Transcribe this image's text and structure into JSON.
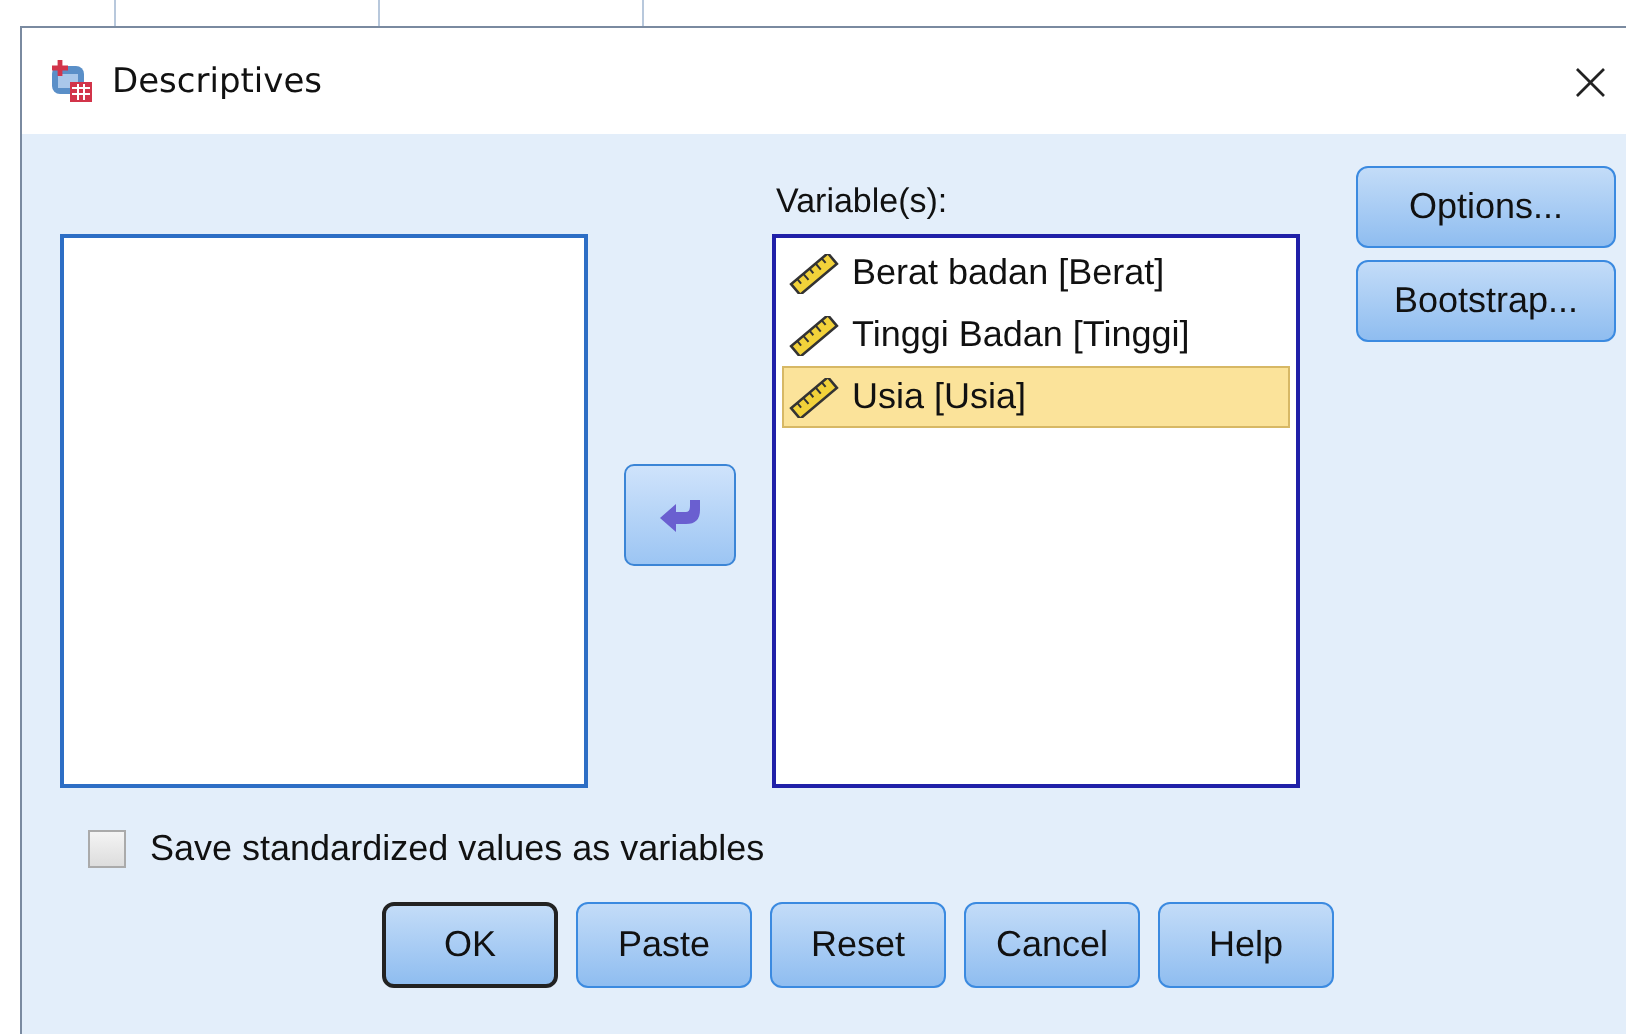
{
  "window": {
    "title": "Descriptives",
    "close": "×"
  },
  "variables": {
    "label": "Variable(s):",
    "items": [
      {
        "label": "Berat badan [Berat]",
        "kind": "scale",
        "selected": false
      },
      {
        "label": "Tinggi Badan [Tinggi]",
        "kind": "scale",
        "selected": false
      },
      {
        "label": "Usia [Usia]",
        "kind": "scale",
        "selected": true
      }
    ]
  },
  "side_buttons": [
    {
      "label": "Options..."
    },
    {
      "label": "Bootstrap..."
    }
  ],
  "save_option": {
    "label": "Save standardized values as variables",
    "checked": false
  },
  "buttons": [
    {
      "label": "OK",
      "default": true
    },
    {
      "label": "Paste",
      "default": false
    },
    {
      "label": "Reset",
      "default": false
    },
    {
      "label": "Cancel",
      "default": false
    },
    {
      "label": "Help",
      "default": false
    }
  ]
}
